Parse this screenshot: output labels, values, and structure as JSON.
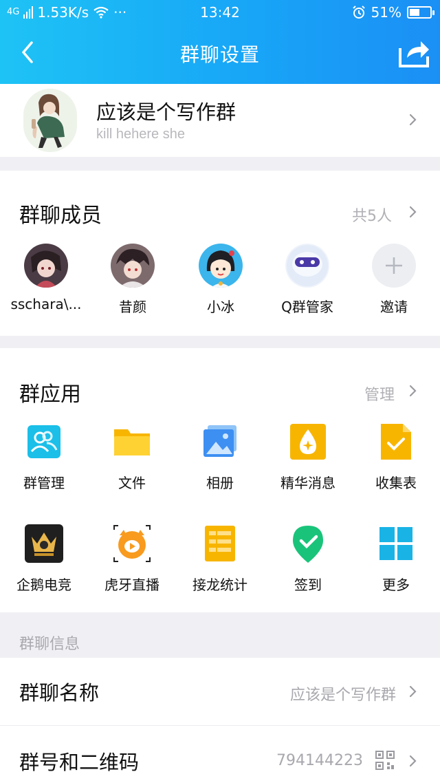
{
  "status_bar": {
    "signal": "4G",
    "net_speed": "1.53K/s",
    "more": "···",
    "time": "13:42",
    "battery": "51%",
    "battery_level": 0.51
  },
  "navbar": {
    "title": "群聊设置"
  },
  "group": {
    "name": "应该是个写作群",
    "description": "kill hehere she"
  },
  "members": {
    "title": "群聊成员",
    "count_label": "共5人",
    "list": [
      {
        "name": "sschara\\..."
      },
      {
        "name": "昔颜"
      },
      {
        "name": "小冰"
      },
      {
        "name": "Q群管家"
      },
      {
        "name": "邀请"
      }
    ]
  },
  "apps": {
    "title": "群应用",
    "manage_label": "管理",
    "items": [
      {
        "label": "群管理",
        "icon": "group-manage-icon"
      },
      {
        "label": "文件",
        "icon": "folder-icon"
      },
      {
        "label": "相册",
        "icon": "photo-album-icon"
      },
      {
        "label": "精华消息",
        "icon": "essence-icon"
      },
      {
        "label": "收集表",
        "icon": "form-icon"
      },
      {
        "label": "企鹅电竞",
        "icon": "esports-icon"
      },
      {
        "label": "虎牙直播",
        "icon": "huya-icon"
      },
      {
        "label": "接龙统计",
        "icon": "list-stats-icon"
      },
      {
        "label": "签到",
        "icon": "checkin-icon"
      },
      {
        "label": "更多",
        "icon": "more-grid-icon"
      }
    ]
  },
  "info": {
    "section_label": "群聊信息",
    "name_row": {
      "label": "群聊名称",
      "value": "应该是个写作群"
    },
    "number_row": {
      "label": "群号和二维码",
      "value": "794144223"
    }
  },
  "colors": {
    "header_gradient_start": "#1ec3f5",
    "header_gradient_end": "#1b8ff5",
    "secondary_text": "#b0b0b5"
  }
}
